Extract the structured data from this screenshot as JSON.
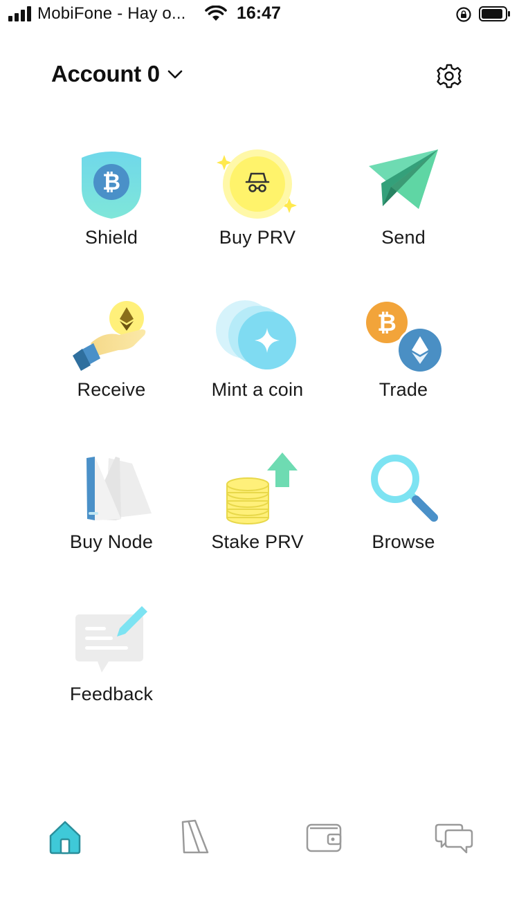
{
  "status_bar": {
    "carrier": "MobiFone - Hay o...",
    "time": "16:47"
  },
  "header": {
    "account_title": "Account 0"
  },
  "actions": [
    {
      "label": "Shield",
      "icon": "shield-bitcoin-icon"
    },
    {
      "label": "Buy PRV",
      "icon": "incognito-coin-icon"
    },
    {
      "label": "Send",
      "icon": "paper-plane-icon"
    },
    {
      "label": "Receive",
      "icon": "hand-ethereum-icon"
    },
    {
      "label": "Mint a coin",
      "icon": "mint-coin-icon"
    },
    {
      "label": "Trade",
      "icon": "btc-eth-swap-icon"
    },
    {
      "label": "Buy Node",
      "icon": "node-device-icon"
    },
    {
      "label": "Stake PRV",
      "icon": "coin-stack-arrow-icon"
    },
    {
      "label": "Browse",
      "icon": "magnifier-icon"
    },
    {
      "label": "Feedback",
      "icon": "feedback-pencil-icon"
    }
  ],
  "tab_bar": {
    "tabs": [
      {
        "icon": "home-icon",
        "active": true
      },
      {
        "icon": "node-icon",
        "active": false
      },
      {
        "icon": "wallet-icon",
        "active": false
      },
      {
        "icon": "chat-icon",
        "active": false
      }
    ]
  },
  "colors": {
    "accent_teal": "#3fc9d8",
    "shield_blue": "#4a90c8",
    "prv_yellow": "#fff36b",
    "send_green": "#5fd6a4",
    "btc_orange": "#f2a43a",
    "eth_blue": "#4a8fc4",
    "inactive_icon": "#9a9a9a"
  }
}
